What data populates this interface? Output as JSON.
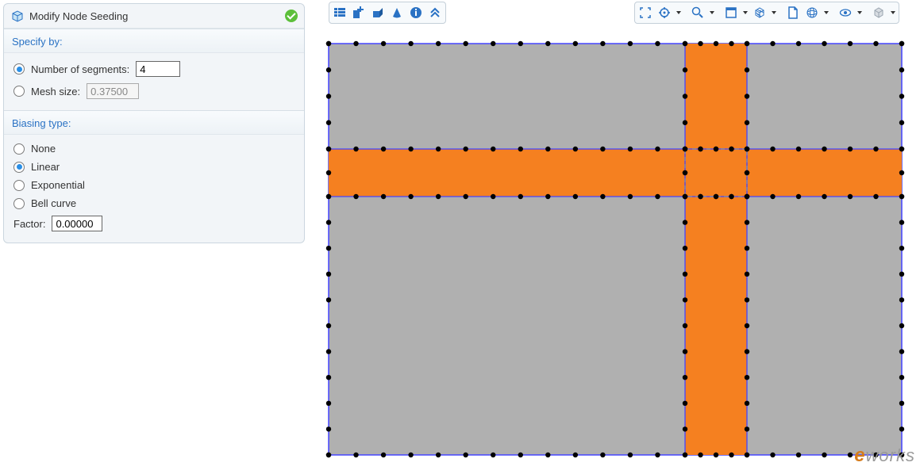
{
  "panel": {
    "title": "Modify Node Seeding",
    "specify": {
      "title": "Specify by:",
      "segments_label": "Number of segments:",
      "segments_value": "4",
      "meshsize_label": "Mesh size:",
      "meshsize_value": "0.37500"
    },
    "biasing": {
      "title": "Biasing type:",
      "none": "None",
      "linear": "Linear",
      "exponential": "Exponential",
      "bell": "Bell curve",
      "factor_label": "Factor:",
      "factor_value": "0.00000"
    }
  },
  "watermark": {
    "prefix": "e",
    "suffix": "works"
  }
}
